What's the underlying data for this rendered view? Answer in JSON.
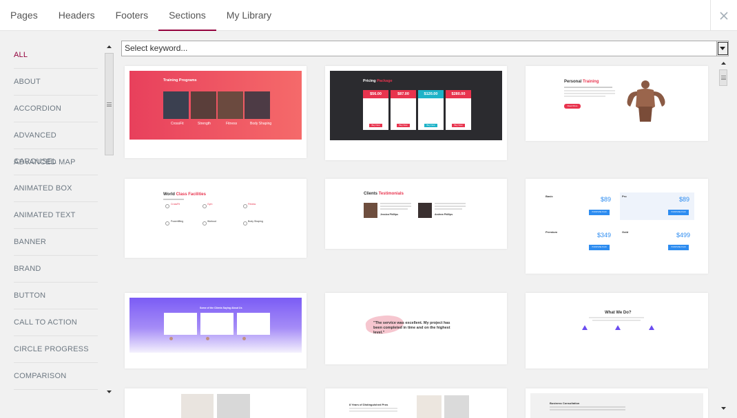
{
  "tabs": [
    {
      "label": "Pages"
    },
    {
      "label": "Headers"
    },
    {
      "label": "Footers"
    },
    {
      "label": "Sections"
    },
    {
      "label": "My Library"
    }
  ],
  "active_tab": "Sections",
  "search": {
    "placeholder": "Select keyword..."
  },
  "categories": [
    {
      "label": "ALL"
    },
    {
      "label": "ABOUT"
    },
    {
      "label": "ACCORDION"
    },
    {
      "label": "ADVANCED CAROUSEL"
    },
    {
      "label": "ADVANCED MAP"
    },
    {
      "label": "ANIMATED BOX"
    },
    {
      "label": "ANIMATED TEXT"
    },
    {
      "label": "BANNER"
    },
    {
      "label": "BRAND"
    },
    {
      "label": "BUTTON"
    },
    {
      "label": "CALL TO ACTION"
    },
    {
      "label": "CIRCLE PROGRESS"
    },
    {
      "label": "COMPARISON"
    }
  ],
  "active_category": "ALL",
  "colors": {
    "accent": "#93003c",
    "red": "#e8344e",
    "blue": "#2d8cf0",
    "purple": "#7b5cf5"
  },
  "cards": {
    "training": {
      "title": "Training Programs",
      "items": [
        "CrossFit",
        "Strength",
        "Fitness",
        "Body Shaping"
      ]
    },
    "pricing": {
      "title_a": "Pricing",
      "title_b": "Package",
      "prices": [
        "$56.00",
        "$87.00",
        "$120.00",
        "$280.00"
      ],
      "button": "Buy Now"
    },
    "personal": {
      "title_a": "Personal",
      "title_b": "Training",
      "button": "Read More"
    },
    "facilities": {
      "title_a": "World",
      "title_b": "Class Facilities",
      "items": [
        "CrossFit",
        "Gym",
        "Fitness",
        "Powerlifting",
        "Workout",
        "Body Shaping"
      ]
    },
    "testimonials": {
      "title_a": "Clients",
      "title_b": "Testimonials",
      "names": [
        "Jessica Phillips",
        "Andrew Phillips"
      ]
    },
    "plans": {
      "names": [
        "Basic",
        "Pro",
        "Premium",
        "Gold"
      ],
      "prices": [
        "$89",
        "$89",
        "$349",
        "$499"
      ],
      "button": "PURCHASE PLAN"
    },
    "clients": {
      "title": "Some of the Clients Saying About Us"
    },
    "quote": {
      "text": "\"The service was excellent. My project has been completed in time and on the highest level.\""
    },
    "whatwedo": {
      "title": "What We Do?"
    },
    "years": {
      "title": "8 Years of Distinguished Pros"
    },
    "business": {
      "title": "Business Consultation"
    }
  }
}
